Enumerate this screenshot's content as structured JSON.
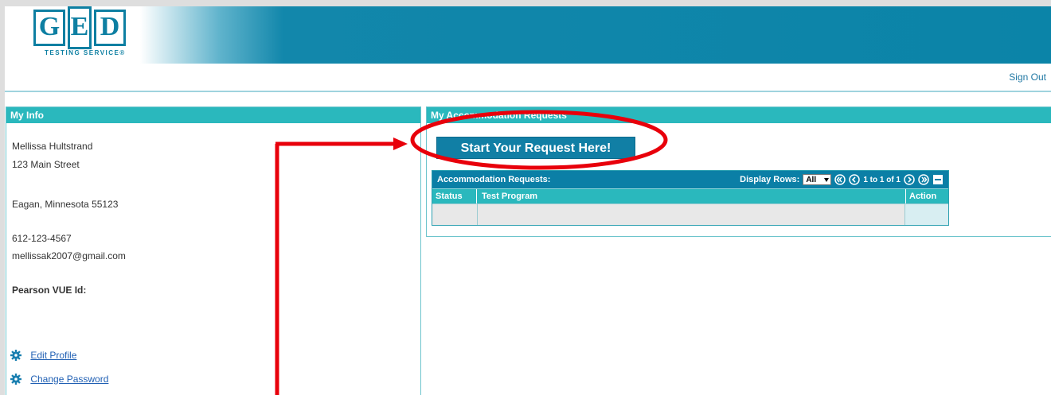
{
  "brand": {
    "logo_letters": [
      "G",
      "E",
      "D"
    ],
    "logo_subtitle": "TESTING SERVICE®",
    "primary_color": "#0b84a8",
    "accent_color": "#2ab8bd"
  },
  "topbar": {
    "sign_out_label": "Sign Out"
  },
  "my_info": {
    "heading": "My Info",
    "name": "Mellissa Hultstrand",
    "street": "123 Main Street",
    "city_line": "Eagan, Minnesota 55123",
    "phone": "612-123-4567",
    "email": "mellissak2007@gmail.com",
    "pearson_label": "Pearson VUE Id:",
    "links": [
      {
        "label": "Edit Profile",
        "icon": "gear-icon"
      },
      {
        "label": "Change Password",
        "icon": "gear-icon"
      }
    ]
  },
  "requests_panel": {
    "heading": "My Accommodation Requests",
    "start_button_label": "Start Your Request Here!",
    "grid": {
      "title": "Accommodation Requests:",
      "display_rows_label": "Display Rows:",
      "display_rows_value": "All",
      "page_info": "1 to 1 of 1",
      "columns": [
        "Status",
        "Test Program",
        "Action"
      ],
      "rows": [
        [
          "",
          "",
          ""
        ]
      ]
    }
  },
  "annotation": {
    "color": "#e8000b",
    "shapes": [
      "ellipse-highlight",
      "arrow-pointer"
    ]
  }
}
